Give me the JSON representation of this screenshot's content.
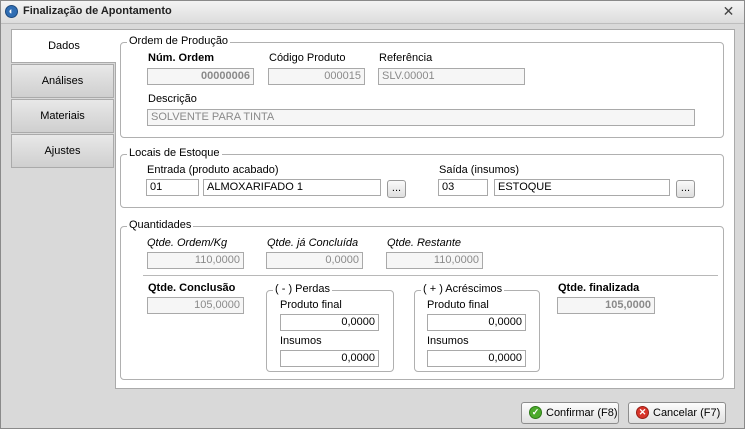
{
  "window": {
    "title": "Finalização de Apontamento",
    "close_glyph": "✕"
  },
  "tabs": [
    {
      "label": "Dados"
    },
    {
      "label": "Análises"
    },
    {
      "label": "Materiais"
    },
    {
      "label": "Ajustes"
    }
  ],
  "ordem": {
    "legend": "Ordem de Produção",
    "num_ordem_label": "Núm. Ordem",
    "num_ordem_value": "00000006",
    "codigo_label": "Código Produto",
    "codigo_value": "000015",
    "referencia_label": "Referência",
    "referencia_value": "SLV.00001",
    "descricao_label": "Descrição",
    "descricao_value": "SOLVENTE PARA TINTA"
  },
  "locais": {
    "legend": "Locais de Estoque",
    "entrada_label": "Entrada (produto acabado)",
    "entrada_code": "01",
    "entrada_name": "ALMOXARIFADO 1",
    "saida_label": "Saída (insumos)",
    "saida_code": "03",
    "saida_name": "ESTOQUE",
    "lookup_label": "..."
  },
  "quantidades": {
    "legend": "Quantidades",
    "ordem_kg_label": "Qtde. Ordem/Kg",
    "ordem_kg_value": "110,0000",
    "concluida_label": "Qtde. já Concluída",
    "concluida_value": "0,0000",
    "restante_label": "Qtde. Restante",
    "restante_value": "110,0000",
    "conclusao_label": "Qtde. Conclusão",
    "conclusao_value": "105,0000",
    "perdas": {
      "legend": "( - ) Perdas",
      "produto_final_label": "Produto final",
      "produto_final_value": "0,0000",
      "insumos_label": "Insumos",
      "insumos_value": "0,0000"
    },
    "acrescimos": {
      "legend": "( + ) Acréscimos",
      "produto_final_label": "Produto final",
      "produto_final_value": "0,0000",
      "insumos_label": "Insumos",
      "insumos_value": "0,0000"
    },
    "finalizada_label": "Qtde. finalizada",
    "finalizada_value": "105,0000"
  },
  "footer": {
    "confirm_label": "Confirmar (F8)",
    "cancel_label": "Cancelar (F7)",
    "confirm_icon": "check-icon",
    "cancel_icon": "cancel-icon"
  }
}
